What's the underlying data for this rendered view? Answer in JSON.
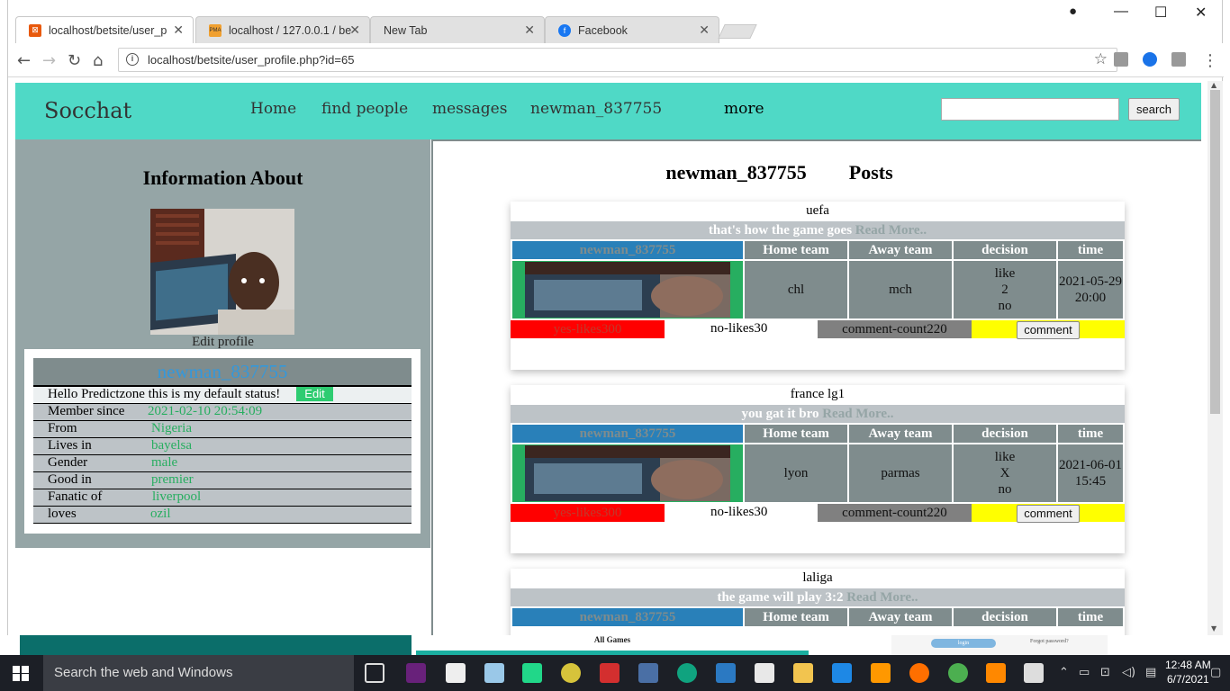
{
  "browser": {
    "tabs": [
      {
        "title": "localhost/betsite/user_p",
        "active": true
      },
      {
        "title": "localhost / 127.0.0.1 / be",
        "active": false
      },
      {
        "title": "New Tab",
        "active": false
      },
      {
        "title": "Facebook",
        "active": false
      }
    ],
    "url": "localhost/betsite/user_profile.php?id=65",
    "url_prefix": "localhost",
    "url_path": "/betsite/user_profile.php?id=65"
  },
  "site": {
    "logo": "Socchat",
    "nav": [
      "Home",
      "find people",
      "messages",
      "newman_837755",
      "more"
    ],
    "search_button": "search",
    "search_value": ""
  },
  "profile": {
    "heading": "Information About",
    "edit_profile": "Edit profile",
    "username": "newman_837755",
    "status": "Hello Predictzone this is my default status!",
    "edit_button": "Edit",
    "fields": [
      {
        "label": "Member since",
        "value": "2021-02-10 20:54:09"
      },
      {
        "label": "From",
        "value": "Nigeria"
      },
      {
        "label": "Lives in",
        "value": "bayelsa"
      },
      {
        "label": "Gender",
        "value": "male"
      },
      {
        "label": "Good in",
        "value": "premier"
      },
      {
        "label": "Fanatic of",
        "value": "liverpool"
      },
      {
        "label": "loves",
        "value": "ozil"
      }
    ]
  },
  "posts_section": {
    "user": "newman_837755",
    "title": "Posts",
    "headers": {
      "home": "Home team",
      "away": "Away team",
      "decision": "decision",
      "time": "time"
    },
    "read_more": "Read More..",
    "posts": [
      {
        "league": "uefa",
        "message": "that's how the game goes",
        "user": "newman_837755",
        "home": "chl",
        "away": "mch",
        "decision": [
          "like",
          "2",
          "no"
        ],
        "time": "2021-05-29 20:00",
        "yes": "yes-likes300",
        "no": "no-likes30",
        "comments": "comment-count220",
        "comment_btn": "comment"
      },
      {
        "league": "france lg1",
        "message": "you gat it bro",
        "user": "newman_837755",
        "home": "lyon",
        "away": "parmas",
        "decision": [
          "like",
          "X",
          "no"
        ],
        "time": "2021-06-01 15:45",
        "yes": "yes-likes300",
        "no": "no-likes30",
        "comments": "comment-count220",
        "comment_btn": "comment"
      },
      {
        "league": "laliga",
        "message": "the game will play 3:2",
        "user": "newman_837755",
        "home": "",
        "away": "",
        "decision": [],
        "time": "",
        "yes": "",
        "no": "",
        "comments": "",
        "comment_btn": ""
      }
    ]
  },
  "taskbar": {
    "search_placeholder": "Search the web and Windows",
    "time": "12:48 AM",
    "date": "6/7/2021"
  },
  "below_fold": {
    "all_games": "All Games",
    "login": "login",
    "forgot": "Forgot password?"
  },
  "colors": {
    "header": "#4fd9c6",
    "panel": "#95a5a6",
    "accent": "#3498db",
    "green": "#27ae60"
  }
}
